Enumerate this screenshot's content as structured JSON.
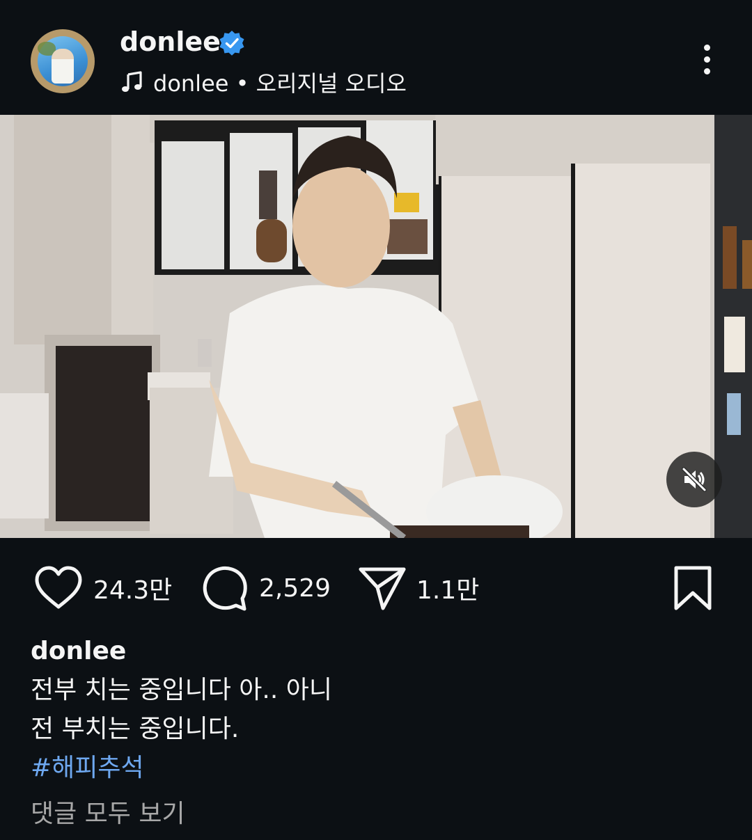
{
  "post": {
    "username": "donlee",
    "verified_icon": "verified-badge-icon",
    "audio": {
      "icon": "music-note-icon",
      "label": "donlee • 오리지널 오디오"
    },
    "more_icon": "more-vertical-icon"
  },
  "media": {
    "mute_icon": "speaker-muted-icon"
  },
  "actions": {
    "likes": "24.3만",
    "comments": "2,529",
    "shares": "1.1만",
    "like_icon": "heart-icon",
    "comment_icon": "comment-bubble-icon",
    "share_icon": "send-icon",
    "save_icon": "bookmark-icon"
  },
  "caption": {
    "username": "donlee",
    "lines": [
      "전부 치는 중입니다 아.. 아니",
      "전 부치는 중입니다."
    ],
    "hashtag": "#해피추석"
  },
  "view_comments": "댓글 모두 보기",
  "colors": {
    "background": "#0c1014",
    "text": "#f5f5f5",
    "hashtag": "#6ea8f0",
    "muted_text": "#a8a8a8",
    "verified": "#3897f0"
  }
}
